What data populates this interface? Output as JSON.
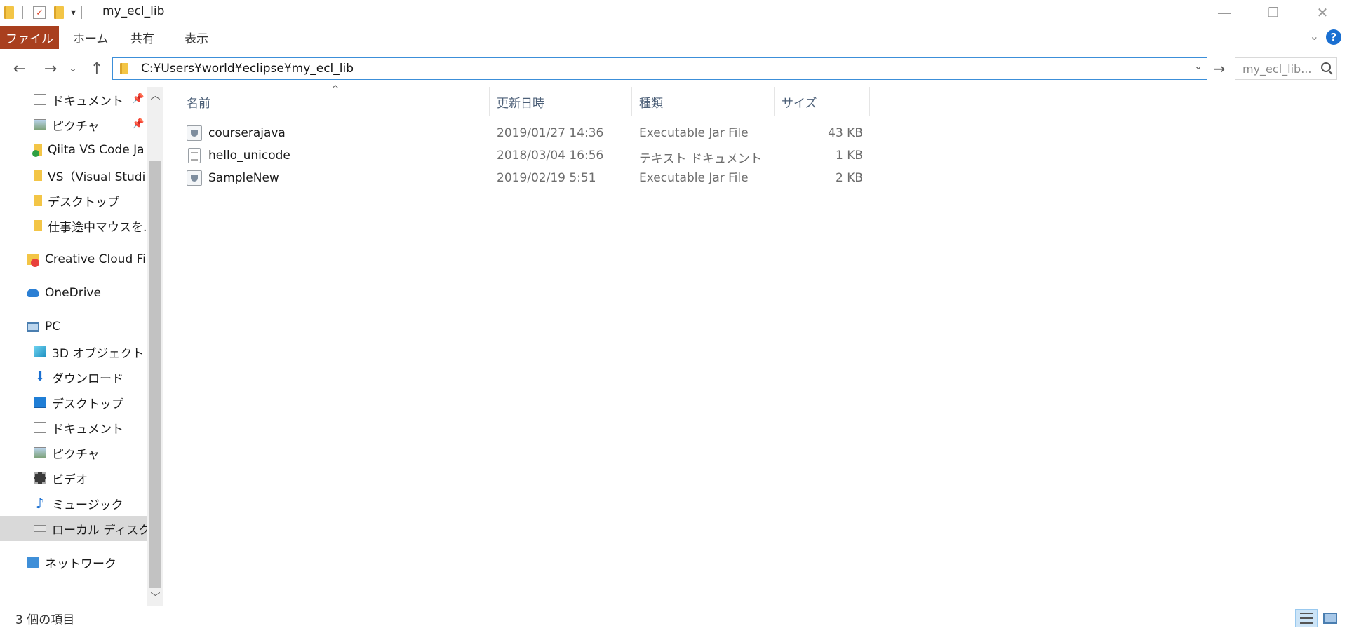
{
  "window": {
    "title": "my_ecl_lib",
    "minimize_glyph": "—",
    "restore_glyph": "❐",
    "close_glyph": "✕",
    "quick_access_dropdown_glyph": "▾"
  },
  "ribbon": {
    "tabs": [
      "ファイル",
      "ホーム",
      "共有",
      "表示"
    ],
    "collapse_glyph": "⌄",
    "help_glyph": "?"
  },
  "navigation": {
    "back_glyph": "←",
    "forward_glyph": "→",
    "recent_glyph": "⌄",
    "up_glyph": "↑",
    "address": "C:¥Users¥world¥eclipse¥my_ecl_lib",
    "address_dropdown_glyph": "⌄",
    "go_glyph": "→",
    "search_placeholder": "my_ecl_lib..."
  },
  "sidebar": {
    "items": [
      {
        "label": "ドキュメント",
        "icon": "documents-icon",
        "pinned": true
      },
      {
        "label": "ピクチャ",
        "icon": "pictures-icon",
        "pinned": true
      },
      {
        "label": "Qiita VS Code Ja",
        "icon": "synced-folder-icon"
      },
      {
        "label": "VS（Visual Studi",
        "icon": "folder-icon"
      },
      {
        "label": "デスクトップ",
        "icon": "folder-icon"
      },
      {
        "label": "仕事途中マウスを.",
        "icon": "folder-icon"
      },
      {
        "label": "Creative Cloud File",
        "icon": "creative-cloud-icon"
      },
      {
        "label": "OneDrive",
        "icon": "onedrive-icon"
      },
      {
        "label": "PC",
        "icon": "pc-icon"
      },
      {
        "label": "3D オブジェクト",
        "icon": "3d-objects-icon"
      },
      {
        "label": "ダウンロード",
        "icon": "downloads-icon"
      },
      {
        "label": "デスクトップ",
        "icon": "desktop-icon"
      },
      {
        "label": "ドキュメント",
        "icon": "documents-icon"
      },
      {
        "label": "ピクチャ",
        "icon": "pictures-icon"
      },
      {
        "label": "ビデオ",
        "icon": "videos-icon"
      },
      {
        "label": "ミュージック",
        "icon": "music-icon"
      },
      {
        "label": "ローカル ディスク (C",
        "icon": "local-disk-icon",
        "selected": true
      },
      {
        "label": "ネットワーク",
        "icon": "network-icon"
      }
    ],
    "pin_glyph": "📌",
    "scroll_up_glyph": "︿",
    "scroll_down_glyph": "﹀"
  },
  "columns": {
    "name": "名前",
    "modified": "更新日時",
    "type": "種類",
    "size": "サイズ",
    "sort_glyph": "^"
  },
  "files": [
    {
      "name": "courserajava",
      "modified": "2019/01/27 14:36",
      "type": "Executable Jar File",
      "size": "43 KB",
      "icon": "jar-file-icon"
    },
    {
      "name": "hello_unicode",
      "modified": "2018/03/04 16:56",
      "type": "テキスト ドキュメント",
      "size": "1 KB",
      "icon": "text-file-icon"
    },
    {
      "name": "SampleNew",
      "modified": "2019/02/19 5:51",
      "type": "Executable Jar File",
      "size": "2 KB",
      "icon": "jar-file-icon"
    }
  ],
  "status": {
    "item_count": "3 個の項目"
  },
  "colors": {
    "file_tab": "#a93f1e",
    "address_border": "#3c8fd9",
    "header_text": "#4d6078",
    "selected_nav": "#d9d9d9"
  }
}
